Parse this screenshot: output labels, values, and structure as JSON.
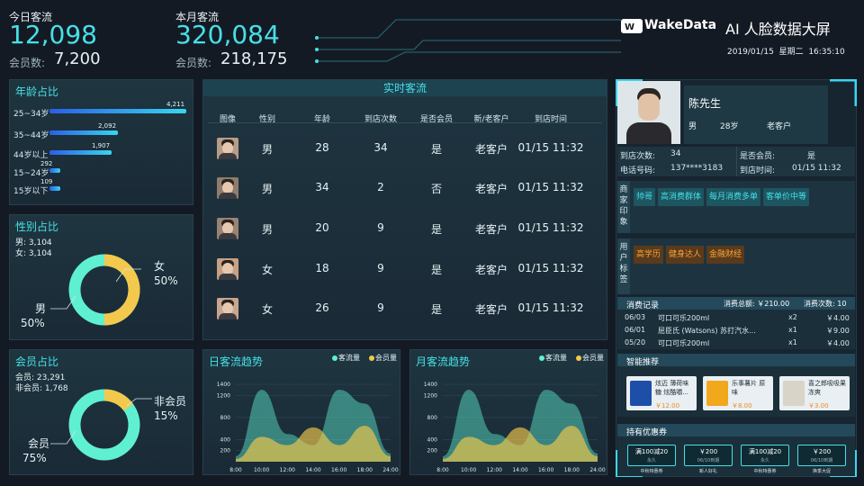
{
  "header": {
    "today_label": "今日客流",
    "today_value": "12,098",
    "today_member_label": "会员数:",
    "today_member_value": "7,200",
    "month_label": "本月客流",
    "month_value": "320,084",
    "month_member_label": "会员数:",
    "month_member_value": "218,175",
    "brand": "WakeData",
    "title": "AI 人脸数据大屏",
    "datetime": "2019/01/15  星期二  16:35:10"
  },
  "age": {
    "title": "年龄占比",
    "items": [
      {
        "label": "25~34岁",
        "value": "4,211",
        "num": 4211
      },
      {
        "label": "35~44岁",
        "value": "2,092",
        "num": 2092
      },
      {
        "label": "44岁以上",
        "value": "1,907",
        "num": 1907
      },
      {
        "label": "15~24岁",
        "value": "292",
        "num": 292
      },
      {
        "label": "15岁以下",
        "value": "109",
        "num": 109
      }
    ]
  },
  "gender": {
    "title": "性别占比",
    "male_line": "男: 3,104",
    "female_line": "女: 3,104",
    "female_label": "女",
    "female_pct": "50%",
    "male_label": "男",
    "male_pct": "50%",
    "female_fraction": 0.5
  },
  "member": {
    "title": "会员占比",
    "member_line": "会员: 23,291",
    "nonmember_line": "非会员: 1,768",
    "nonmember_label": "非会员",
    "nonmember_pct": "15%",
    "member_label": "会员",
    "member_pct": "75%",
    "nonmember_fraction": 0.15
  },
  "realtime": {
    "title": "实时客流",
    "headers": [
      "图像",
      "性别",
      "年龄",
      "到店次数",
      "是否会员",
      "新/老客户",
      "到店时间"
    ],
    "rows": [
      {
        "gender": "男",
        "age": "28",
        "visits": "34",
        "member": "是",
        "type": "老客户",
        "time": "01/15 11:32"
      },
      {
        "gender": "男",
        "age": "34",
        "visits": "2",
        "member": "否",
        "type": "老客户",
        "time": "01/15 11:32"
      },
      {
        "gender": "男",
        "age": "20",
        "visits": "9",
        "member": "是",
        "type": "老客户",
        "time": "01/15 11:32"
      },
      {
        "gender": "女",
        "age": "18",
        "visits": "9",
        "member": "是",
        "type": "老客户",
        "time": "01/15 11:32"
      },
      {
        "gender": "女",
        "age": "26",
        "visits": "9",
        "member": "是",
        "type": "老客户",
        "time": "01/15 11:32"
      }
    ]
  },
  "daily": {
    "title": "日客流趋势",
    "legend_a": "客流量",
    "legend_b": "会员量",
    "yticks": [
      "1400",
      "1200",
      "800",
      "400",
      "200"
    ],
    "xticks": [
      "8:00",
      "10:00",
      "12:00",
      "14:00",
      "16:00",
      "18:00",
      "24:00"
    ]
  },
  "monthly": {
    "title": "月客流趋势",
    "legend_a": "客流量",
    "legend_b": "会员量",
    "yticks": [
      "1400",
      "1200",
      "800",
      "400",
      "200"
    ],
    "xticks": [
      "8:00",
      "10:00",
      "12:00",
      "14:00",
      "16:00",
      "18:00",
      "24:00"
    ]
  },
  "chart_data": [
    {
      "type": "area",
      "title": "日客流趋势",
      "x": [
        "8:00",
        "10:00",
        "12:00",
        "14:00",
        "16:00",
        "18:00",
        "24:00"
      ],
      "ylim": [
        0,
        1400
      ],
      "series": [
        {
          "name": "客流量",
          "values": [
            100,
            1300,
            500,
            300,
            1300,
            1050,
            150
          ]
        },
        {
          "name": "会员量",
          "values": [
            50,
            450,
            300,
            620,
            300,
            650,
            100
          ]
        }
      ]
    },
    {
      "type": "area",
      "title": "月客流趋势",
      "x": [
        "8:00",
        "10:00",
        "12:00",
        "14:00",
        "16:00",
        "18:00",
        "24:00"
      ],
      "ylim": [
        0,
        1400
      ],
      "series": [
        {
          "name": "客流量",
          "values": [
            100,
            1300,
            500,
            300,
            1300,
            1050,
            150
          ]
        },
        {
          "name": "会员量",
          "values": [
            50,
            450,
            300,
            620,
            300,
            650,
            100
          ]
        }
      ]
    }
  ],
  "customer": {
    "name": "陈先生",
    "gender": "男",
    "age": "28岁",
    "type": "老客户",
    "visits_label": "到店次数:",
    "visits_value": "34",
    "member_label": "是否会员:",
    "member_value": "是",
    "phone_label": "电话号码:",
    "phone_value": "137****3183",
    "time_label": "到店时间:",
    "time_value": "01/15 11:32",
    "impression_label": "商家印象",
    "impression_tags": [
      "帅哥",
      "高消费群体",
      "每月消费多单",
      "客单价中等"
    ],
    "user_label": "用户标签",
    "user_tags": [
      "高学历",
      "健身达人",
      "金融财经"
    ],
    "records_title": "消费记录",
    "records_total": "消费总额: ￥210.00",
    "records_count": "消费次数: 10",
    "records": [
      {
        "date": "06/03",
        "item": "可口可乐200ml",
        "qty": "x2",
        "price": "￥4.00"
      },
      {
        "date": "06/01",
        "item": "屈臣氏 (Watsons) 苏打汽水...",
        "qty": "x1",
        "price": "￥9.00"
      },
      {
        "date": "05/20",
        "item": "可口可乐200ml",
        "qty": "x1",
        "price": "￥4.00"
      }
    ],
    "recommend_title": "智能推荐",
    "products": [
      {
        "name": "炫迈 薄荷味糖 炫酷嚼...",
        "price": "￥12.00"
      },
      {
        "name": "乐事薯片 原味",
        "price": "￥8.00"
      },
      {
        "name": "喜之郎吸吸果冻爽",
        "price": "￥3.00"
      }
    ],
    "coupon_title": "持有优惠券",
    "coupons": [
      {
        "amount": "满100减20",
        "sub": "永久",
        "caption": "中秋特惠券"
      },
      {
        "amount": "￥200",
        "sub": "06/10到期",
        "caption": "新人好礼"
      },
      {
        "amount": "满100减20",
        "sub": "永久",
        "caption": "中秋特惠券"
      },
      {
        "amount": "￥200",
        "sub": "06/10到期",
        "caption": "换季大促"
      }
    ]
  },
  "colors": {
    "accent": "#46e0e6",
    "yellow": "#f2c94c",
    "teal": "#5ff0d2",
    "bar_start": "#2b5fe6",
    "bar_end": "#39d6f0"
  }
}
